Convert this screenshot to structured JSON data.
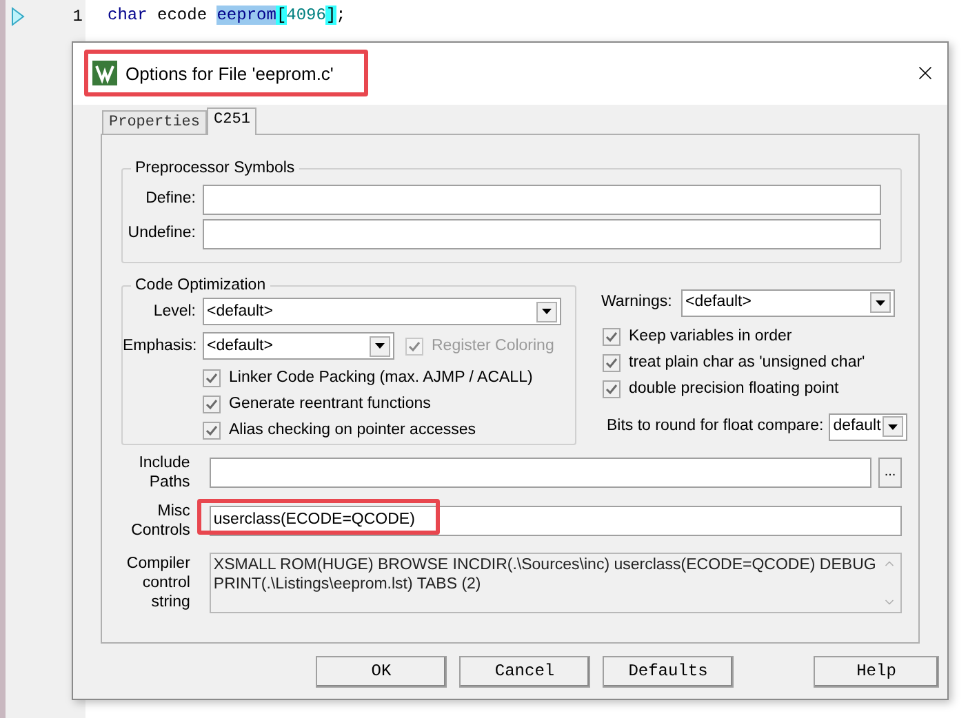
{
  "editor": {
    "line_number": "1",
    "tokens": [
      {
        "text": "char",
        "kind": "keyword"
      },
      {
        "text": " ecode ",
        "kind": "plain"
      },
      {
        "text": "eeprom",
        "kind": "selected"
      },
      {
        "text": "[",
        "kind": "brace"
      },
      {
        "text": "4096",
        "kind": "number"
      },
      {
        "text": "]",
        "kind": "brace"
      },
      {
        "text": ";",
        "kind": "plain"
      }
    ]
  },
  "dialog": {
    "title": "Options for File 'eeprom.c'",
    "title_highlighted": true,
    "tabs": [
      {
        "label": "Properties",
        "selected": false
      },
      {
        "label": "C251",
        "selected": true
      }
    ],
    "preprocessor": {
      "title": "Preprocessor Symbols",
      "fields": [
        {
          "label": "Define:"
        },
        {
          "label": "Undefine:"
        }
      ]
    },
    "code_optimization": {
      "title": "Code Optimization",
      "level": {
        "label": "Level:",
        "value": "<default>"
      },
      "emphasis": {
        "label": "Emphasis:",
        "value": "<default>"
      },
      "register_coloring": {
        "label": "Register Coloring",
        "checked": true,
        "disabled": true
      },
      "options": [
        {
          "label": "Linker Code Packing (max. AJMP / ACALL)",
          "checked": true,
          "disabled": false
        },
        {
          "label": "Generate reentrant functions",
          "checked": true,
          "disabled": false
        },
        {
          "label": "Alias checking on pointer accesses",
          "checked": true,
          "disabled": false
        }
      ]
    },
    "warnings": {
      "label": "Warnings:",
      "value": "<default>"
    },
    "options": [
      {
        "label": "Keep variables in order",
        "checked": true,
        "disabled": false
      },
      {
        "label": "treat plain char as 'unsigned char'",
        "checked": true,
        "disabled": false
      },
      {
        "label": "double precision floating point",
        "checked": true,
        "disabled": false
      }
    ],
    "float_compare": {
      "label": "Bits to round for float compare:",
      "value": "default"
    },
    "include_paths": {
      "label": "Include Paths",
      "browse": "..."
    },
    "misc_controls": {
      "label": "Misc Controls",
      "value": "userclass(ECODE=QCODE)",
      "highlighted": true
    },
    "compiler_control_string": {
      "label": "Compiler control string",
      "value": "XSMALL ROM(HUGE) BROWSE INCDIR(.\\Sources\\inc) userclass(ECODE=QCODE) DEBUG PRINT(.\\Listings\\eeprom.lst) TABS (2)"
    },
    "buttons": [
      "OK",
      "Cancel",
      "Defaults",
      "Help"
    ]
  }
}
